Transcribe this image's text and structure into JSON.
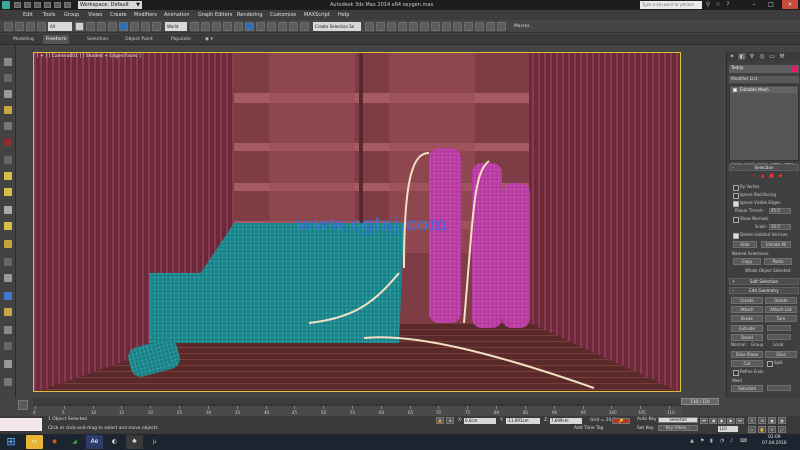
{
  "titlebar": {
    "workspace": "Workspace: Default",
    "app_title": "Autodesk 3ds Max  2014 x64      oxygen.max",
    "search_placeholder": "Type a keyword or phrase",
    "controls": [
      "–",
      "□",
      "✕"
    ]
  },
  "menubar": {
    "items": [
      "Edit",
      "Tools",
      "Group",
      "Views",
      "Create",
      "Modifiers",
      "Animation",
      "Graph Editors",
      "Rendering",
      "Customize",
      "MAXScript",
      "Help"
    ]
  },
  "toolbar": {
    "selection_filter": "All",
    "coord_system": "World",
    "named_selection": "Create Selection Se",
    "macros_label": "Macros"
  },
  "ribbon": {
    "tabs": [
      "Modeling",
      "Freeform",
      "Selection",
      "Object Paint",
      "Populate"
    ],
    "active_tab": "Freeform"
  },
  "viewport": {
    "label": "[ + ] [ Camera001 ] [ Shaded + Edged Faces ]",
    "watermark": "www.cgtsj.com"
  },
  "command_panel": {
    "object_name": "Teddy",
    "object_color": "#e11a6a",
    "modifier_list_label": "Modifier List",
    "stack_item": "Editable Mesh",
    "selection_rollout": "Selection",
    "checks": [
      "By Vertex",
      "Ignore Backfacing",
      "Ignore Visible Edges"
    ],
    "planar_thresh_label": "Planar Thresh:",
    "planar_thresh_value": "45.0",
    "show_normals": "Show Normals",
    "scale_label": "Scale:",
    "scale_value": "20.0",
    "delete_isolated": "Delete Isolated Vertices",
    "hide_btn": "Hide",
    "unhide_btn": "Unhide All",
    "named_selections": "Named Selections:",
    "copy_btn": "Copy",
    "paste_btn": "Paste",
    "whole_status": "Whole Object Selected",
    "soft_selection": "Soft Selection",
    "edit_geometry": "Edit Geometry",
    "create_btn": "Create",
    "delete_btn": "Delete",
    "attach_btn": "Attach",
    "attach_list_btn": "Attach List",
    "break_btn": "Break",
    "turn_btn": "Turn",
    "extrude_label": "Extrude",
    "bevel_label": "Bevel",
    "normal_label": "Normal:",
    "group_label": "Group",
    "local_label": "Local",
    "slice_plane_btn": "Slice Plane",
    "slice_btn": "Slice",
    "cut_btn": "Cut",
    "split_btn": "Split",
    "refine_ends": "Refine Ends",
    "weld_label": "Weld",
    "selected_btn": "Selected",
    "target_btn": "Target"
  },
  "timeline": {
    "frame_display": "110 / 110",
    "ticks": [
      "0",
      "5",
      "10",
      "15",
      "20",
      "25",
      "30",
      "35",
      "40",
      "45",
      "50",
      "55",
      "60",
      "65",
      "70",
      "75",
      "80",
      "85",
      "90",
      "95",
      "100",
      "105",
      "110"
    ]
  },
  "statusbar": {
    "selected_text": "1 Object Selected",
    "prompt_text": "Click or click-and-drag to select and move objects",
    "x_label": "X:",
    "x_value": "0,0cm",
    "y_label": "Y:",
    "y_value": "-11,991cm",
    "z_label": "Z:",
    "z_value": "7,699cm",
    "grid": "Grid = 20,0cm",
    "add_time_tag": "Add Time Tag",
    "auto_key": "Auto Key",
    "selected_dropdown": "Selected",
    "set_key": "Set Key",
    "key_filters": "Key Filters...",
    "frame_field": "110"
  },
  "taskbar": {
    "time": "02:09",
    "date": "07.04.2016"
  }
}
